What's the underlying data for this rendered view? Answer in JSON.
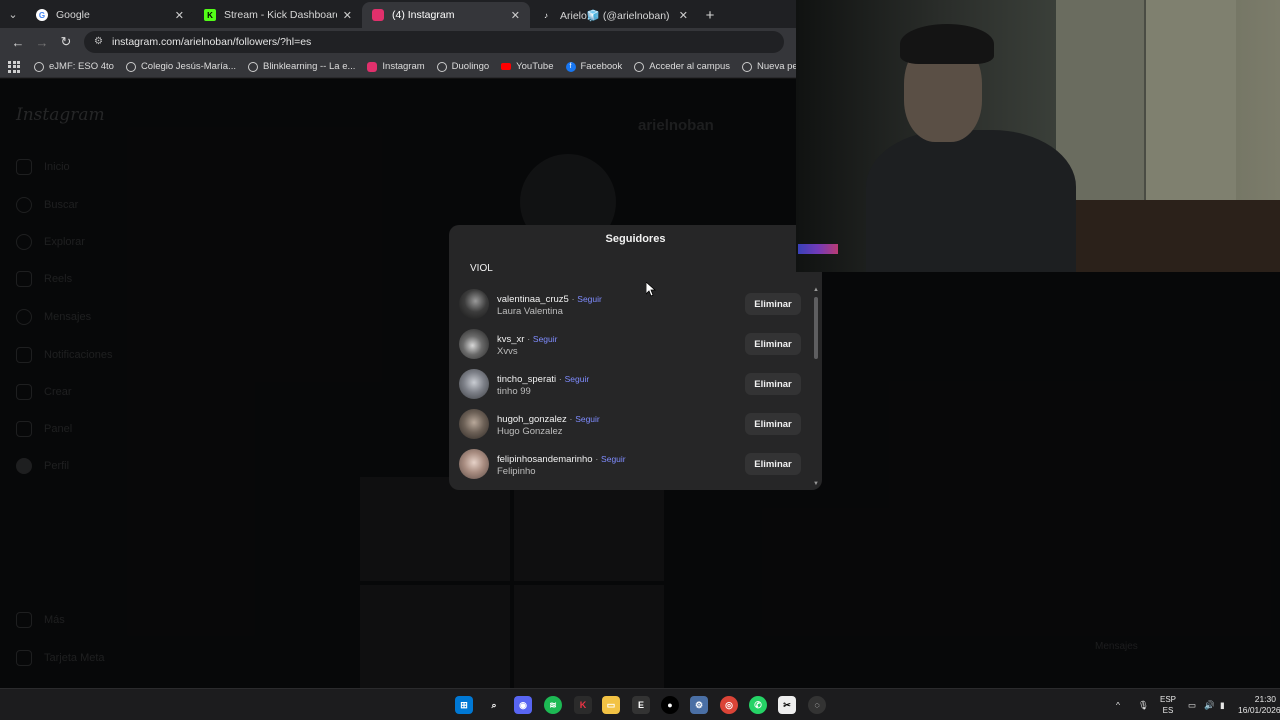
{
  "browser": {
    "tabs": [
      {
        "title": "Google",
        "favicon": "google-icon",
        "color": "#4285f4",
        "active": false
      },
      {
        "title": "Stream - Kick Dashboard",
        "favicon": "kick-icon",
        "color": "#53fc18",
        "active": false
      },
      {
        "title": "(4) Instagram",
        "favicon": "instagram-icon",
        "color": "#e1306c",
        "active": true
      },
      {
        "title": "Arielo🧊 (@arielnoban) | TikTok",
        "favicon": "tiktok-icon",
        "color": "#ffffff",
        "active": false
      }
    ],
    "url": "instagram.com/arielnoban/followers/?hl=es",
    "bookmarks": [
      "eJMF: ESO 4to",
      "Colegio Jesús-María...",
      "Blinklearning -- La e...",
      "Instagram",
      "Duolingo",
      "YouTube",
      "Facebook",
      "Acceder al campus",
      "Nueva pestaña"
    ]
  },
  "background": {
    "logo": "Instagram",
    "profile_name": "arielnoban",
    "nav": [
      "Inicio",
      "Buscar",
      "Explorar",
      "Reels",
      "Mensajes",
      "Notificaciones",
      "Crear",
      "Panel",
      "Perfil",
      "Más",
      "Tarjeta Meta"
    ],
    "messages_label": "Mensajes"
  },
  "modal": {
    "title": "Seguidores",
    "search_value": "VIOL",
    "follow_label": "Seguir",
    "remove_label": "Eliminar",
    "followers": [
      {
        "username": "valentinaa_cruz5",
        "fullname": "Laura Valentina"
      },
      {
        "username": "kvs_xr",
        "fullname": "Xvvs"
      },
      {
        "username": "tincho_sperati",
        "fullname": "tinho 99"
      },
      {
        "username": "hugoh_gonzalez",
        "fullname": "Hugo Gonzalez"
      },
      {
        "username": "felipinhosandemarinho",
        "fullname": "Felipinho"
      }
    ]
  },
  "taskbar": {
    "language": "ESP",
    "region": "ES",
    "time": "21:30",
    "date": "16/01/2026"
  },
  "colors": {
    "modal_bg": "#262627",
    "follow_link": "#7f8cff",
    "page_bg": "#0c0d0e"
  }
}
